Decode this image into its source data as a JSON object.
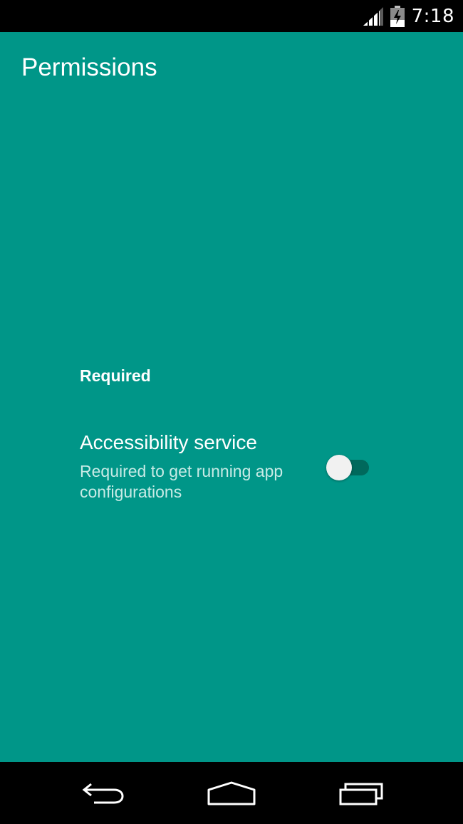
{
  "status_bar": {
    "time": "7:18",
    "icons": [
      "cellular-signal-icon",
      "battery-charging-icon"
    ]
  },
  "app": {
    "title": "Permissions",
    "background_color": "#009688",
    "sections": [
      {
        "header": "Required",
        "items": [
          {
            "title": "Accessibility service",
            "summary": "Required to get running app configurations",
            "switch_on": false
          }
        ]
      }
    ]
  },
  "nav_bar": {
    "buttons": [
      "back-icon",
      "home-icon",
      "recents-icon"
    ]
  }
}
